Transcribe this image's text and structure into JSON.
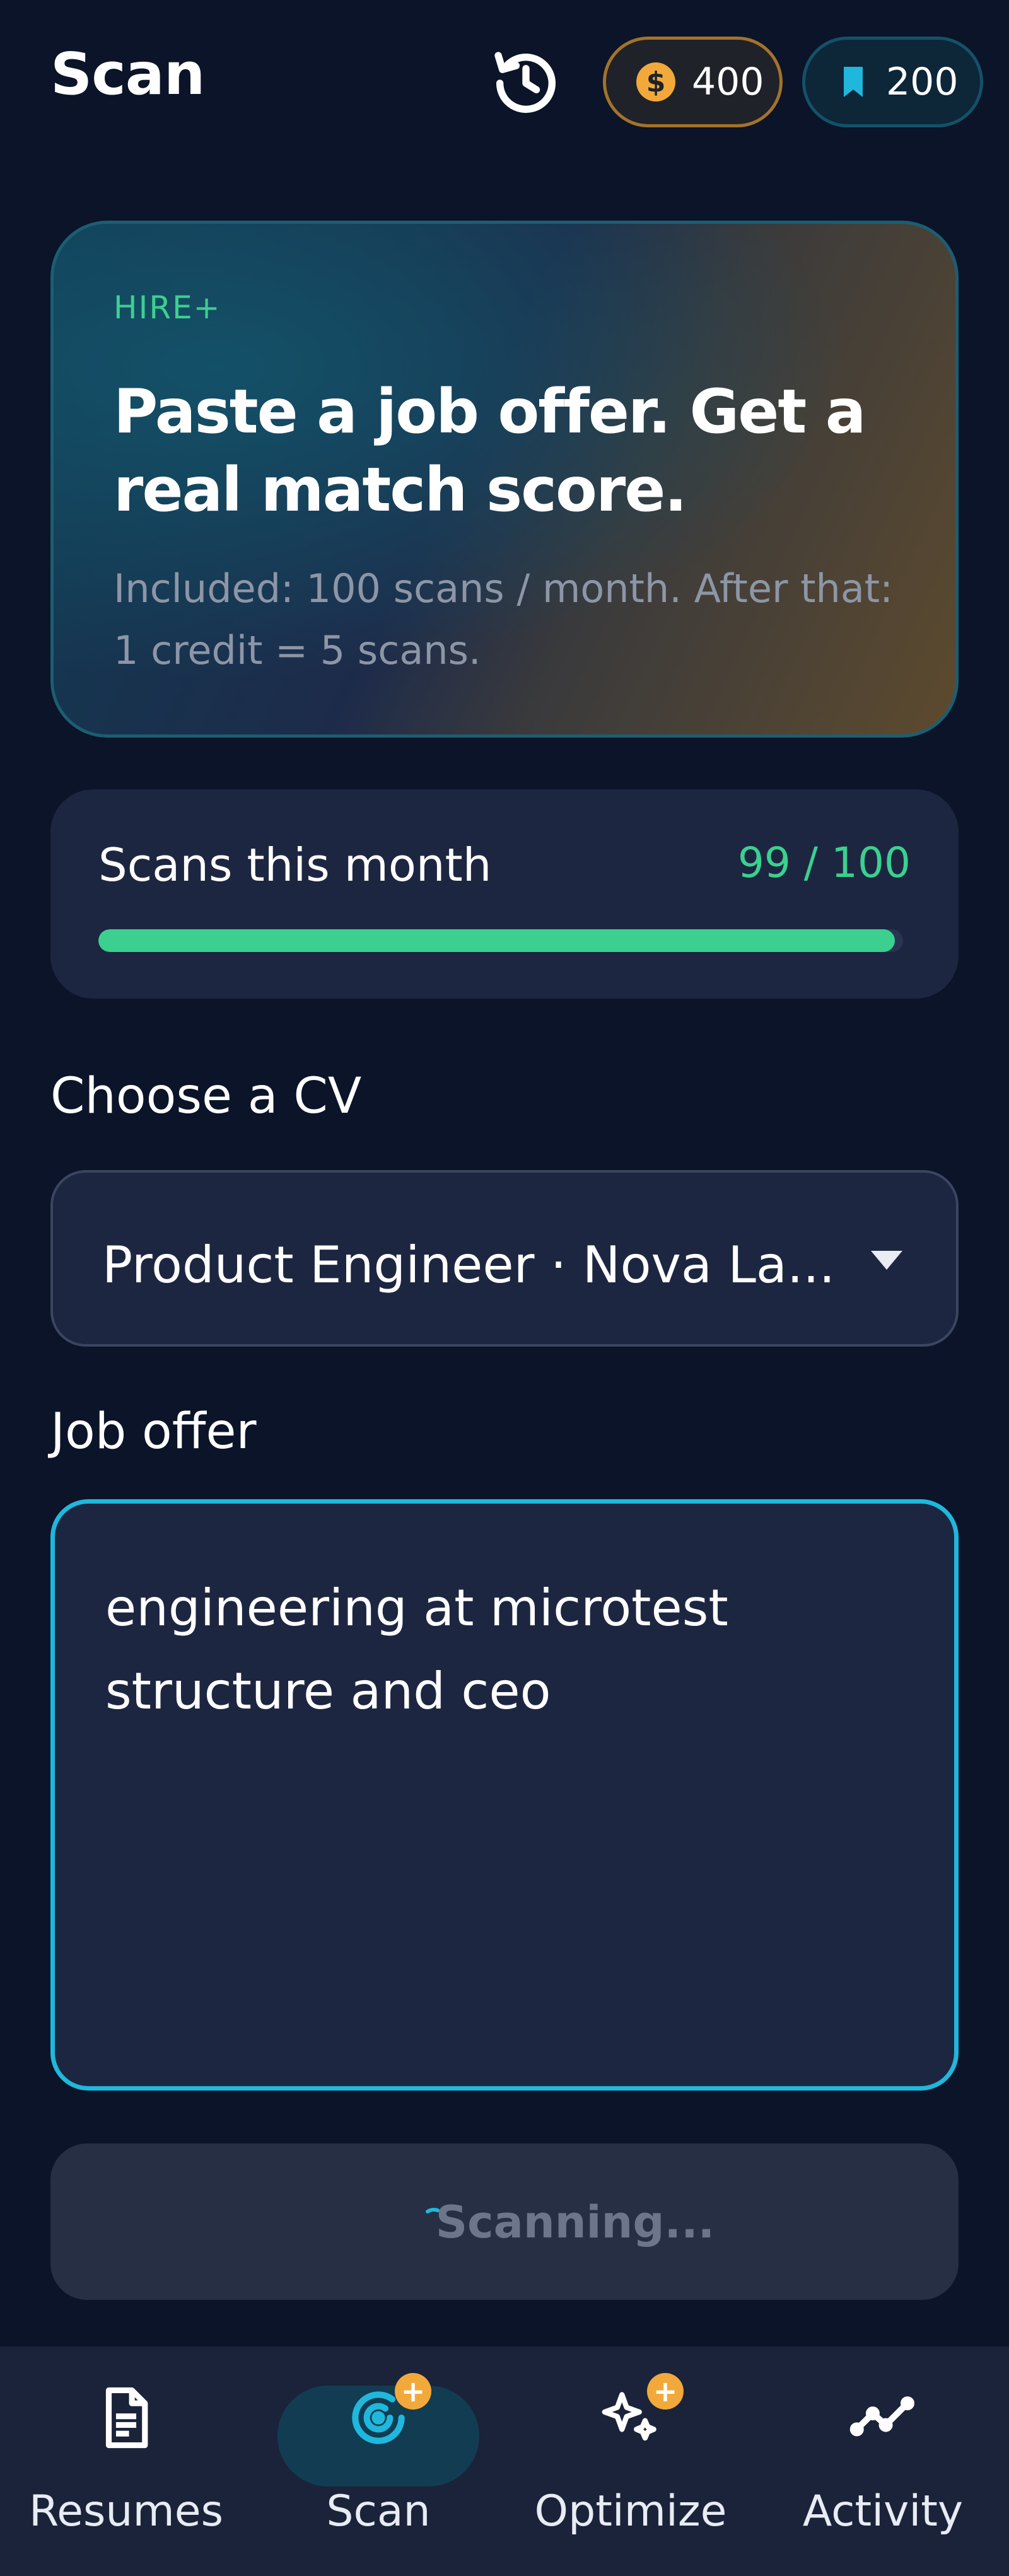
{
  "header": {
    "title": "Scan",
    "coins": "400",
    "saves": "200"
  },
  "hero": {
    "tag": "HIRE+",
    "title": "Paste a job offer. Get a real match score.",
    "subtitle": "Included: 100 scans / month. After that: 1 credit = 5 scans."
  },
  "usage": {
    "label": "Scans this month",
    "count_text": "99 / 100",
    "used": 99,
    "limit": 100
  },
  "cv": {
    "label": "Choose a CV",
    "selected": "Product Engineer · Nova La..."
  },
  "job_offer": {
    "label": "Job offer",
    "value": "engineering at microtest structure and ceo"
  },
  "scan_button": {
    "label": "Scanning..."
  },
  "nav": {
    "items": [
      {
        "label": "Resumes",
        "icon": "document-icon",
        "active": false
      },
      {
        "label": "Scan",
        "icon": "scan-target-icon",
        "active": true,
        "badge": "+"
      },
      {
        "label": "Optimize",
        "icon": "sparkles-icon",
        "active": false,
        "badge": "+"
      },
      {
        "label": "Activity",
        "icon": "activity-chart-icon",
        "active": false
      }
    ]
  },
  "colors": {
    "background": "#0b1428",
    "accent_green": "#3bd08f",
    "accent_cyan": "#1fb8dc",
    "coin_orange": "#f2a93b"
  }
}
